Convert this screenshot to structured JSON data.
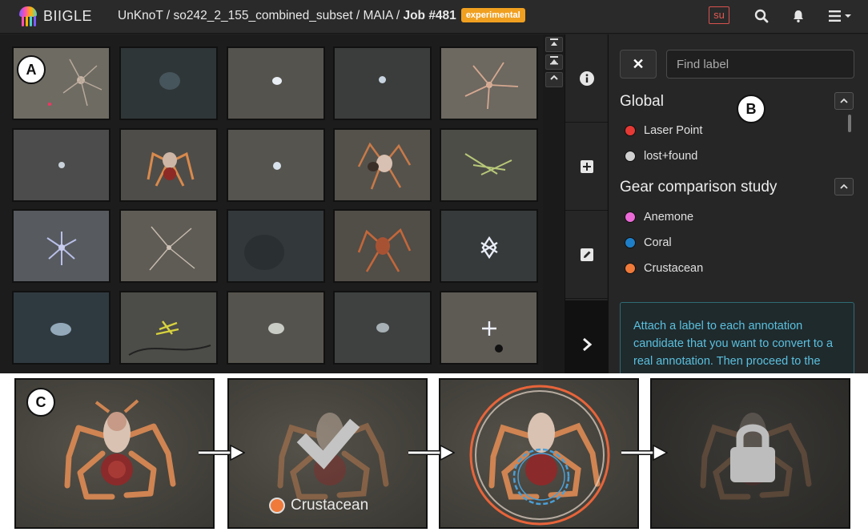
{
  "app": {
    "brand": "BIIGLE"
  },
  "breadcrumb": {
    "path": "UnKnoT / so242_2_155_combined_subset / MAIA / ",
    "job": "Job #481",
    "badge": "experimental"
  },
  "navbar": {
    "user_badge": "su",
    "icons": [
      "search-icon",
      "bell-icon",
      "menu-icon"
    ]
  },
  "sidebar": {
    "close_label": "✕",
    "search_placeholder": "Find label",
    "groups": [
      {
        "title": "Global",
        "labels": [
          {
            "name": "Laser Point",
            "color": "#e53935"
          },
          {
            "name": "lost+found",
            "color": "#cfcfcf"
          }
        ]
      },
      {
        "title": "Gear comparison study",
        "labels": [
          {
            "name": "Anemone",
            "color": "#ec6ad8"
          },
          {
            "name": "Coral",
            "color": "#1e7fc8"
          },
          {
            "name": "Crustacean",
            "color": "#f07a3a"
          }
        ]
      }
    ],
    "info_text": "Attach a label to each annotation candidate that you want to convert to a real annotation. Then proceed to the refinement of the annotation"
  },
  "tabs": [
    "info-icon",
    "plus-icon",
    "edit-icon",
    "chevron-right-icon"
  ],
  "callouts": {
    "a": "A",
    "b": "B",
    "c": "C"
  },
  "workflow": {
    "selected_label": "Crustacean",
    "selected_label_color": "#f07a3a"
  },
  "colors": {
    "background": "#222222",
    "accent_orange": "#f0a020",
    "info_text": "#5bc0de",
    "ring_orange": "#e8643a",
    "ring_blue": "#4a9fd8"
  }
}
